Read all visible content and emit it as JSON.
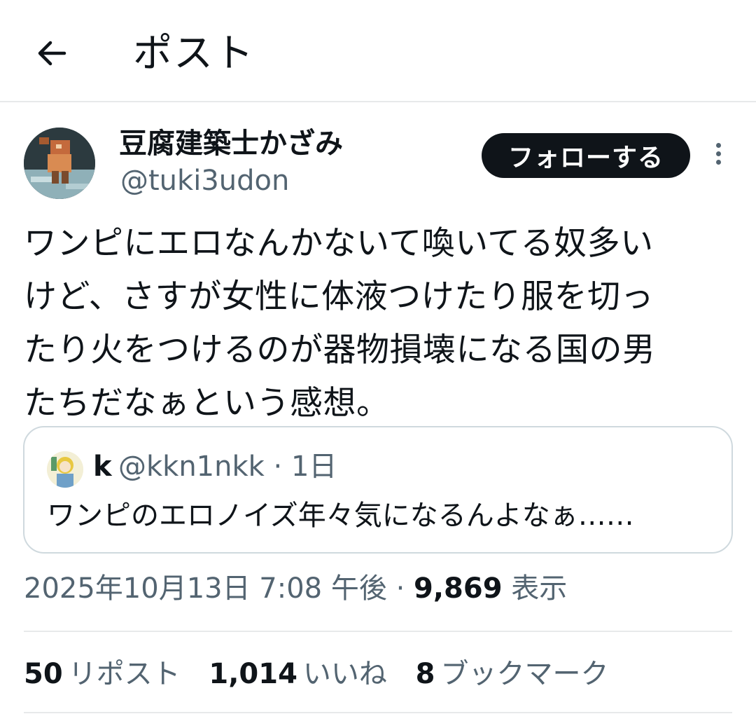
{
  "header": {
    "title": "ポスト",
    "back_icon": "arrow-left-icon"
  },
  "author": {
    "display_name": "豆腐建築士かざみ",
    "handle": "@tuki3udon",
    "follow_label": "フォローする",
    "more_icon": "more-vertical-icon"
  },
  "tweet": {
    "text": "ワンピにエロなんかないて喚いてる奴多い\nけど、さすが女性に体液つけたり服を切っ\nたり火をつけるのが器物損壊になる国の男\nたちだなぁという感想。"
  },
  "quote": {
    "name": "k",
    "handle": "@kkn1nkk",
    "separator": " · ",
    "time": "1日",
    "text": "ワンピのエロノイズ年々気になるんよなぁ……"
  },
  "meta": {
    "timestamp": "2025年10月13日 7:08 午後",
    "separator": " · ",
    "views_count": "9,869",
    "views_label": "表示"
  },
  "stats": [
    {
      "count": "50",
      "label": "リポスト"
    },
    {
      "count": "1,014",
      "label": "いいね"
    },
    {
      "count": "8",
      "label": "ブックマーク"
    }
  ],
  "colors": {
    "text": "#0f1419",
    "secondary": "#536471",
    "border": "#cfd9de",
    "button_bg": "#0f1419"
  }
}
